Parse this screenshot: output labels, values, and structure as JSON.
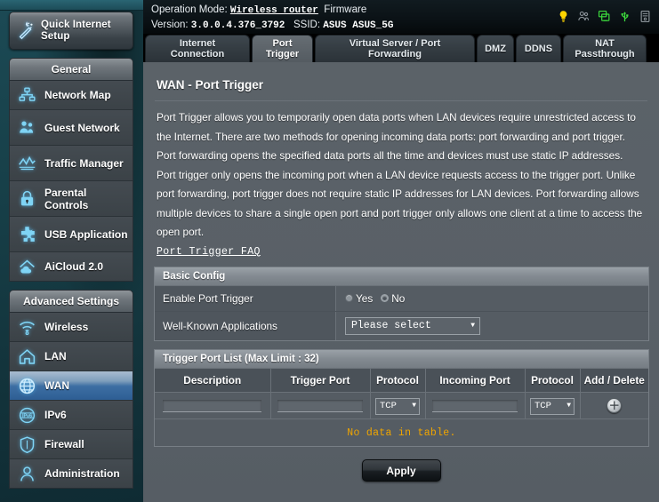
{
  "header": {
    "operation_mode_label": "Operation Mode:",
    "operation_mode_value": "Wireless router",
    "firmware_label": "Firmware",
    "version_label": "Version:",
    "version_value": "3.0.0.4.376_3792",
    "ssid_label": "SSID:",
    "ssid_value": "ASUS ASUS_5G",
    "icons": [
      {
        "name": "notification-bulb-icon",
        "color": "#ffd400"
      },
      {
        "name": "guest-users-icon",
        "color": "#8c949a"
      },
      {
        "name": "clients-monitor-icon",
        "color": "#3ddc3d"
      },
      {
        "name": "usb-icon",
        "color": "#3ddc3d"
      },
      {
        "name": "printer-server-icon",
        "color": "#8c949a"
      }
    ]
  },
  "tabs": [
    {
      "label": "Internet\nConnection",
      "active": false
    },
    {
      "label": "Port\nTrigger",
      "active": true
    },
    {
      "label": "Virtual Server / Port\nForwarding",
      "active": false
    },
    {
      "label": "DMZ",
      "active": false
    },
    {
      "label": "DDNS",
      "active": false
    },
    {
      "label": "NAT\nPassthrough",
      "active": false
    }
  ],
  "sidebar": {
    "quick_setup": {
      "label": "Quick Internet Setup",
      "icon": "magic-wand-icon"
    },
    "groups": [
      {
        "title": "General",
        "items": [
          {
            "label": "Network Map",
            "icon": "network-map-icon",
            "active": false
          },
          {
            "label": "Guest Network",
            "icon": "guest-network-icon",
            "active": false
          },
          {
            "label": "Traffic Manager",
            "icon": "traffic-manager-icon",
            "active": false
          },
          {
            "label": "Parental Controls",
            "icon": "lock-icon",
            "active": false
          },
          {
            "label": "USB Application",
            "icon": "puzzle-icon",
            "active": false
          },
          {
            "label": "AiCloud 2.0",
            "icon": "cloud-home-icon",
            "active": false
          }
        ]
      },
      {
        "title": "Advanced Settings",
        "items": [
          {
            "label": "Wireless",
            "icon": "wifi-icon",
            "active": false
          },
          {
            "label": "LAN",
            "icon": "home-icon",
            "active": false
          },
          {
            "label": "WAN",
            "icon": "globe-icon",
            "active": true
          },
          {
            "label": "IPv6",
            "icon": "ipv6-globe-icon",
            "active": false
          },
          {
            "label": "Firewall",
            "icon": "shield-icon",
            "active": false
          },
          {
            "label": "Administration",
            "icon": "user-icon",
            "active": false
          }
        ]
      }
    ]
  },
  "main": {
    "page_title": "WAN - Port Trigger",
    "description": "Port Trigger allows you to temporarily open data ports when LAN devices require unrestricted access to the Internet. There are two methods for opening incoming data ports: port forwarding and port trigger. Port forwarding opens the specified data ports all the time and devices must use static IP addresses. Port trigger only opens the incoming port when a LAN device requests access to the trigger port. Unlike port forwarding, port trigger does not require static IP addresses for LAN devices. Port forwarding allows multiple devices to share a single open port and port trigger only allows one client at a time to access the open port.",
    "faq_link": "Port Trigger FAQ",
    "basic_config": {
      "title": "Basic Config",
      "enable_label": "Enable Port Trigger",
      "radio_yes": "Yes",
      "radio_no": "No",
      "selected": "Yes",
      "wka_label": "Well-Known Applications",
      "wka_value": "Please select"
    },
    "trigger_table": {
      "title": "Trigger Port List (Max Limit : 32)",
      "columns": [
        "Description",
        "Trigger Port",
        "Protocol",
        "Incoming Port",
        "Protocol",
        "Add / Delete"
      ],
      "input_row": {
        "description": "",
        "trigger_port": "",
        "protocol_1": "TCP",
        "incoming_port": "",
        "protocol_2": "TCP",
        "add_icon": "plus-circle-icon"
      },
      "empty_message": "No data in table."
    },
    "apply_label": "Apply"
  },
  "colors": {
    "accent_blue": "#2e5e94",
    "warning_amber": "#f0a500",
    "panel_bg": "#555c63",
    "sidebar_teal": "#174049"
  }
}
